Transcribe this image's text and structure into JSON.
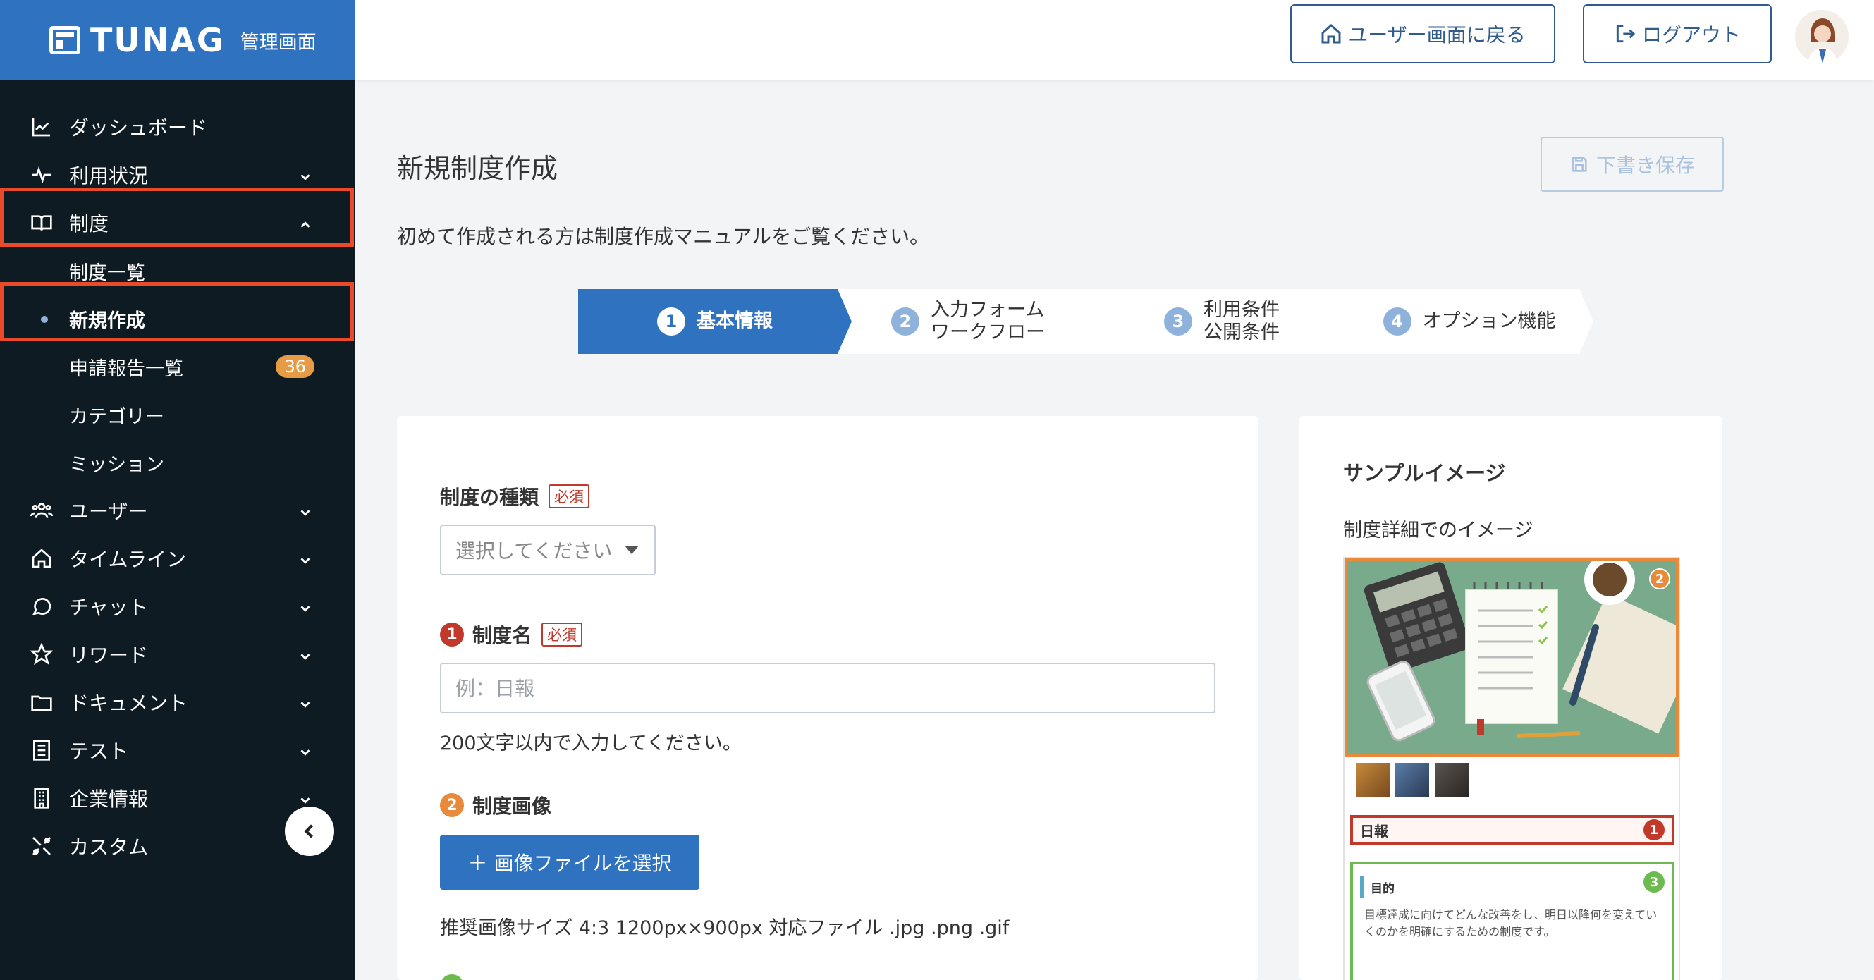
{
  "brand": {
    "logo": "TUNAG",
    "subtitle": "管理画面"
  },
  "sidebar": {
    "items": [
      {
        "label": "ダッシュボード",
        "icon": "chart-line-icon"
      },
      {
        "label": "利用状況",
        "icon": "pulse-icon"
      },
      {
        "label": "制度",
        "icon": "book-icon"
      },
      {
        "label": "ユーザー",
        "icon": "users-icon"
      },
      {
        "label": "タイムライン",
        "icon": "home-icon"
      },
      {
        "label": "チャット",
        "icon": "chat-icon"
      },
      {
        "label": "リワード",
        "icon": "star-icon"
      },
      {
        "label": "ドキュメント",
        "icon": "folder-icon"
      },
      {
        "label": "テスト",
        "icon": "checklist-icon"
      },
      {
        "label": "企業情報",
        "icon": "building-icon"
      },
      {
        "label": "カスタム",
        "icon": "tools-icon"
      }
    ],
    "sub_items": [
      {
        "label": "制度一覧"
      },
      {
        "label": "新規作成"
      },
      {
        "label": "申請報告一覧",
        "badge": "36"
      },
      {
        "label": "カテゴリー"
      },
      {
        "label": "ミッション"
      }
    ]
  },
  "header": {
    "user_screen_button": "ユーザー画面に戻る",
    "logout_button": "ログアウト"
  },
  "page": {
    "title": "新規制度作成",
    "draft_button": "下書き保存",
    "intro": "初めて作成される方は制度作成マニュアルをご覧ください。"
  },
  "steps": [
    {
      "num": "1",
      "label": "基本情報"
    },
    {
      "num": "2",
      "label_line1": "入力フォーム",
      "label_line2": "ワークフロー"
    },
    {
      "num": "3",
      "label_line1": "利用条件",
      "label_line2": "公開条件"
    },
    {
      "num": "4",
      "label": "オプション機能"
    }
  ],
  "form": {
    "required_tag": "必須",
    "type_label": "制度の種類",
    "type_select_value": "選択してください",
    "name_num": "1",
    "name_label": "制度名",
    "name_placeholder": "例：日報",
    "name_help": "200文字以内で入力してください。",
    "image_num": "2",
    "image_label": "制度画像",
    "upload_button": "＋ 画像ファイルを選択",
    "image_help": "推奨画像サイズ 4:3 1200px×900px 対応ファイル .jpg .png .gif"
  },
  "sample": {
    "title": "サンプルイメージ",
    "subtitle": "制度詳細でのイメージ",
    "preview_title": "日報",
    "preview_body_head": "目的",
    "preview_body_text": "目標達成に向けてどんな改善をし、明日以降何を変えていくのかを明確にするための制度です。",
    "marker_1": "1",
    "marker_2": "2",
    "marker_3": "3"
  },
  "colors": {
    "primary": "#2f72c0",
    "sidebar_bg": "#0e1b22",
    "highlight": "#e94a2a",
    "marker_1": "#c0392b",
    "marker_2": "#e88a3a",
    "marker_3": "#6dbb4f"
  }
}
